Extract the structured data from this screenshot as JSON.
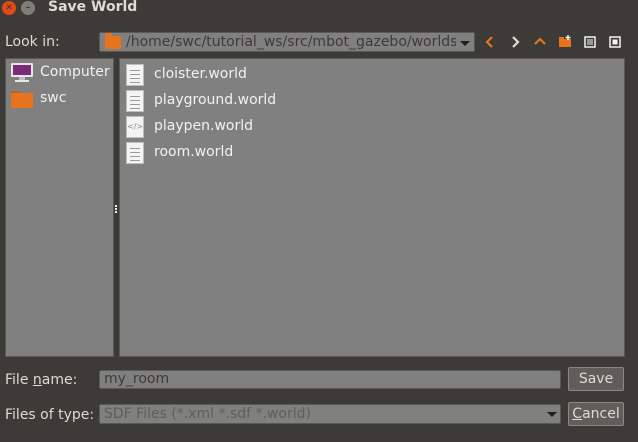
{
  "window": {
    "title": "Save World"
  },
  "toolbar": {
    "look_in_label": "Look in:",
    "path": "/home/swc/tutorial_ws/src/mbot_gazebo/worlds"
  },
  "sidebar": {
    "items": [
      {
        "label": "Computer",
        "icon": "computer-icon"
      },
      {
        "label": "swc",
        "icon": "folder-icon"
      }
    ]
  },
  "files": [
    {
      "name": "cloister.world",
      "icon": "text-file-icon"
    },
    {
      "name": "playground.world",
      "icon": "text-file-icon"
    },
    {
      "name": "playpen.world",
      "icon": "xml-file-icon"
    },
    {
      "name": "room.world",
      "icon": "text-file-icon"
    }
  ],
  "form": {
    "file_name_label_pre": "File ",
    "file_name_label_u": "n",
    "file_name_label_post": "ame:",
    "file_name_value": "my_room",
    "file_type_label": "Files of type:",
    "file_type_value": "SDF Files (*.xml *.sdf *.world)"
  },
  "buttons": {
    "save": "Save",
    "cancel_u": "C",
    "cancel_rest": "ancel"
  },
  "colors": {
    "window_bg": "#3c3b37",
    "panel_bg": "#808080",
    "accent": "#e5741d",
    "close": "#df4a16"
  }
}
